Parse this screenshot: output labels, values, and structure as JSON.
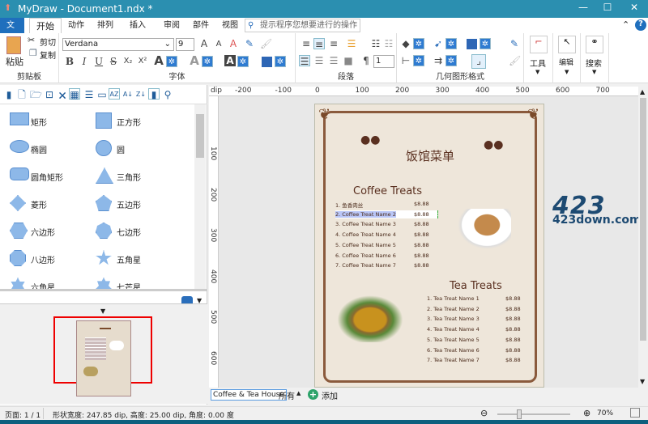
{
  "window": {
    "title": "MyDraw - Document1.ndx *"
  },
  "tabs": [
    {
      "label": "文件"
    },
    {
      "label": "开始"
    },
    {
      "label": "动作"
    },
    {
      "label": "排列"
    },
    {
      "label": "插入"
    },
    {
      "label": "审阅"
    },
    {
      "label": "部件"
    },
    {
      "label": "视图"
    }
  ],
  "search": {
    "placeholder": "提示程序您想要进行的操作"
  },
  "ribbon": {
    "clipboard": {
      "paste": "粘贴",
      "cut": "剪切",
      "copy": "复制",
      "label": "剪贴板"
    },
    "font": {
      "family": "Verdana",
      "size": "9",
      "label": "字体",
      "buttons": [
        "B",
        "I",
        "U",
        "S",
        "X₂",
        "X²"
      ]
    },
    "paragraph": {
      "label": "段落",
      "spacing": "1"
    },
    "geometry": {
      "label": "几何图形格式"
    },
    "tools": "工具",
    "edit": "编辑",
    "find": "搜索"
  },
  "shapes": [
    {
      "label": "矩形"
    },
    {
      "label": "正方形"
    },
    {
      "label": "椭圆"
    },
    {
      "label": "圆"
    },
    {
      "label": "圆角矩形"
    },
    {
      "label": "三角形"
    },
    {
      "label": "菱形"
    },
    {
      "label": "五边形"
    },
    {
      "label": "六边形"
    },
    {
      "label": "七边形"
    },
    {
      "label": "八边形"
    },
    {
      "label": "五角星"
    },
    {
      "label": "六角星"
    },
    {
      "label": "七芒星"
    }
  ],
  "ruler": {
    "unit": "dip",
    "top": [
      "-200",
      "-100",
      "0",
      "100",
      "200",
      "300",
      "400",
      "500",
      "600",
      "700"
    ],
    "left": [
      "100",
      "200",
      "300",
      "400",
      "500",
      "600"
    ]
  },
  "menu": {
    "title": "饭馆菜单",
    "coffee_heading": "Coffee Treats",
    "coffee": [
      {
        "name": "1. 鱼香肉丝",
        "price": "$8.88"
      },
      {
        "name": "2. Coffee Treat Name 2",
        "price": "$8.88"
      },
      {
        "name": "3. Coffee Treat Name 3",
        "price": "$8.88"
      },
      {
        "name": "4. Coffee Treat Name 4",
        "price": "$8.88"
      },
      {
        "name": "5. Coffee Treat Name 5",
        "price": "$8.88"
      },
      {
        "name": "6. Coffee Treat Name 6",
        "price": "$8.88"
      },
      {
        "name": "7. Coffee Treat Name 7",
        "price": "$8.88"
      }
    ],
    "tea_heading": "Tea Treats",
    "tea": [
      {
        "name": "1. Tea Treat Name 1",
        "price": "$8.88"
      },
      {
        "name": "2. Tea Treat Name 2",
        "price": "$8.88"
      },
      {
        "name": "3. Tea Treat Name 3",
        "price": "$8.88"
      },
      {
        "name": "4. Tea Treat Name 4",
        "price": "$8.88"
      },
      {
        "name": "5. Tea Treat Name 5",
        "price": "$8.88"
      },
      {
        "name": "6. Tea Treat Name 6",
        "price": "$8.88"
      },
      {
        "name": "7. Tea Treat Name 7",
        "price": "$8.88"
      }
    ]
  },
  "watermark": "423down.com",
  "sheets": {
    "current": "Coffee & Tea House",
    "all": "所有",
    "add": "添加"
  },
  "status": {
    "page": "页面: 1 / 1",
    "shape": "形状宽度: 247.85 dip, 高度: 25.00 dip, 角度: 0.00 度",
    "zoom": "70%",
    "zoom_fraction": 0.3
  }
}
